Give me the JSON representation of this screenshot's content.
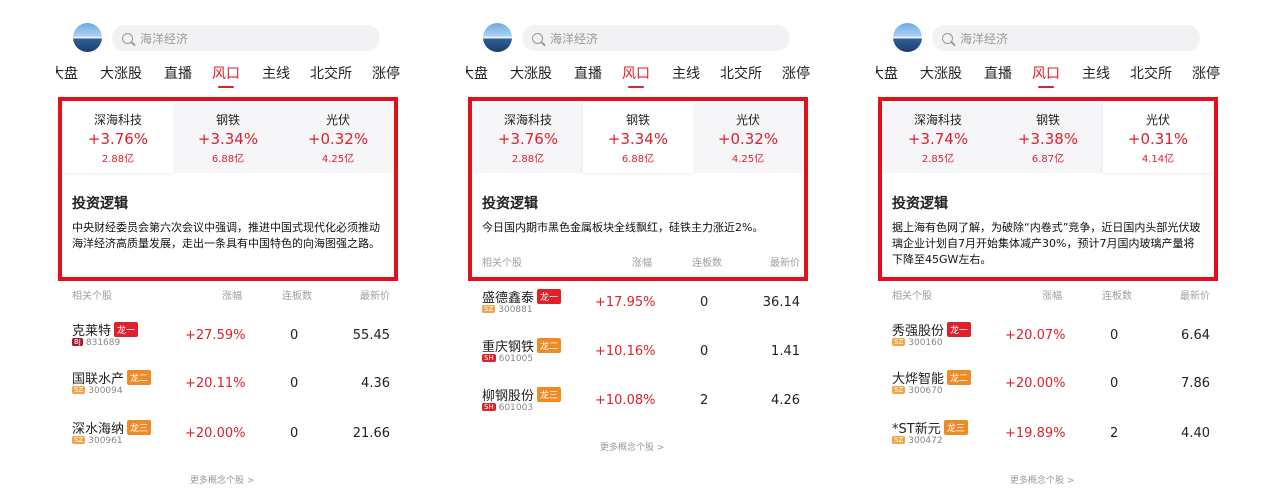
{
  "search": {
    "placeholder": "海洋经济"
  },
  "tabs": [
    "大盘",
    "大涨股",
    "直播",
    "风口",
    "主线",
    "北交所",
    "涨停"
  ],
  "active_tab": "风口",
  "accent_color": "#e0202b",
  "highlight_color": "#e30f1a",
  "logic_title": "投资逻辑",
  "table_headers": {
    "name": "相关个股",
    "change": "涨幅",
    "streak": "连板数",
    "price": "最新价"
  },
  "more_label": "更多概念个股 >",
  "panels": [
    {
      "selected_sector": 0,
      "sectors": [
        {
          "name": "深海科技",
          "change": "+3.76%",
          "amount": "2.88亿"
        },
        {
          "name": "钢铁",
          "change": "+3.34%",
          "amount": "6.88亿"
        },
        {
          "name": "光伏",
          "change": "+0.32%",
          "amount": "4.25亿"
        }
      ],
      "logic_text": "中央财经委员会第六次会议中强调，推进中国式现代化必须推动海洋经济高质量发展，走出一条具有中国特色的向海图强之路。",
      "stocks": [
        {
          "name": "克莱特",
          "dragon": "龙一",
          "market": "BJ",
          "code": "831689",
          "change": "+27.59%",
          "streak": "0",
          "price": "55.45"
        },
        {
          "name": "国联水产",
          "dragon": "龙二",
          "market": "SZ",
          "code": "300094",
          "change": "+20.11%",
          "streak": "0",
          "price": "4.36"
        },
        {
          "name": "深水海纳",
          "dragon": "龙三",
          "market": "SZ",
          "code": "300961",
          "change": "+20.00%",
          "streak": "0",
          "price": "21.66"
        }
      ]
    },
    {
      "selected_sector": 1,
      "sectors": [
        {
          "name": "深海科技",
          "change": "+3.76%",
          "amount": "2.88亿"
        },
        {
          "name": "钢铁",
          "change": "+3.34%",
          "amount": "6.88亿"
        },
        {
          "name": "光伏",
          "change": "+0.32%",
          "amount": "4.25亿"
        }
      ],
      "logic_text": "今日国内期市黑色金属板块全线飘红，硅铁主力涨近2%。",
      "stocks": [
        {
          "name": "盛德鑫泰",
          "dragon": "龙一",
          "market": "SZ",
          "code": "300881",
          "change": "+17.95%",
          "streak": "0",
          "price": "36.14"
        },
        {
          "name": "重庆钢铁",
          "dragon": "龙二",
          "market": "SH",
          "code": "601005",
          "change": "+10.16%",
          "streak": "0",
          "price": "1.41"
        },
        {
          "name": "柳钢股份",
          "dragon": "龙三",
          "market": "SH",
          "code": "601003",
          "change": "+10.08%",
          "streak": "2",
          "price": "4.26"
        }
      ]
    },
    {
      "selected_sector": 2,
      "sectors": [
        {
          "name": "深海科技",
          "change": "+3.74%",
          "amount": "2.85亿"
        },
        {
          "name": "钢铁",
          "change": "+3.38%",
          "amount": "6.87亿"
        },
        {
          "name": "光伏",
          "change": "+0.31%",
          "amount": "4.14亿"
        }
      ],
      "logic_text": "据上海有色网了解，为破除“内卷式”竞争，近日国内头部光伏玻璃企业计划自7月开始集体减产30%，预计7月国内玻璃产量将下降至45GW左右。",
      "stocks": [
        {
          "name": "秀强股份",
          "dragon": "龙一",
          "market": "SZ",
          "code": "300160",
          "change": "+20.07%",
          "streak": "0",
          "price": "6.64"
        },
        {
          "name": "大烨智能",
          "dragon": "龙二",
          "market": "SZ",
          "code": "300670",
          "change": "+20.00%",
          "streak": "0",
          "price": "7.86"
        },
        {
          "name": "*ST新元",
          "dragon": "龙三",
          "market": "SZ",
          "code": "300472",
          "change": "+19.89%",
          "streak": "2",
          "price": "4.40"
        }
      ]
    }
  ]
}
